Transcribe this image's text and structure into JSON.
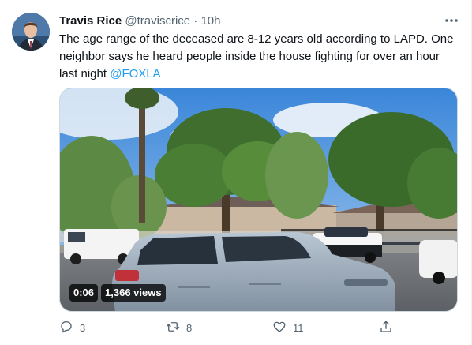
{
  "tweet": {
    "author_name": "Travis Rice",
    "author_handle": "@traviscrice",
    "separator": "·",
    "time": "10h",
    "text": "The age range of the deceased are 8-12 years old according to LAPD. One neighbor says he heard people inside the house fighting for over an hour last night ",
    "mention": "@FOXLA"
  },
  "video": {
    "duration": "0:06",
    "views": "1,366 views"
  },
  "actions": {
    "reply_count": "3",
    "retweet_count": "8",
    "like_count": "11"
  },
  "icons": {
    "more": "more-icon",
    "reply": "reply-icon",
    "retweet": "retweet-icon",
    "like": "like-icon",
    "share": "share-icon"
  },
  "colors": {
    "accent": "#1d9bf0",
    "text": "#0f1419",
    "secondary": "#536471"
  }
}
